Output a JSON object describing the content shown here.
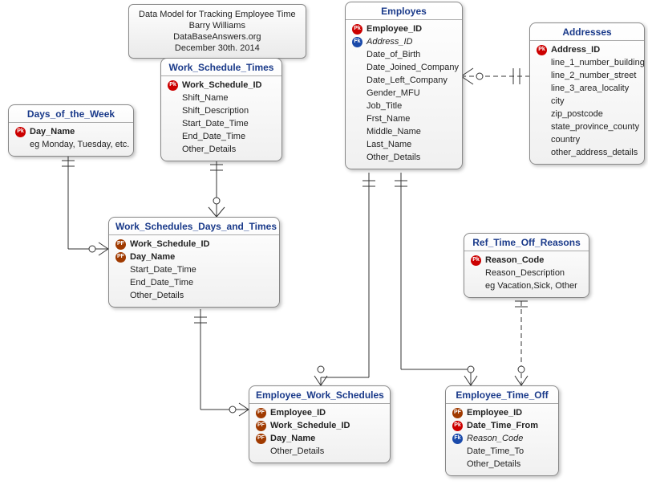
{
  "info_box": {
    "line1": "Data Model for Tracking Employee Time",
    "line2": "Barry Williams",
    "line3": "DataBaseAnswers.org",
    "line4": "December 30th. 2014"
  },
  "entities": {
    "employees": {
      "title": "Employes",
      "attrs": [
        {
          "key": "PK",
          "name": "Employee_ID",
          "bold": true
        },
        {
          "key": "FK",
          "name": "Address_ID",
          "italic": true
        },
        {
          "key": "",
          "name": "Date_of_Birth"
        },
        {
          "key": "",
          "name": "Date_Joined_Company"
        },
        {
          "key": "",
          "name": "Date_Left_Company"
        },
        {
          "key": "",
          "name": "Gender_MFU"
        },
        {
          "key": "",
          "name": "Job_Title"
        },
        {
          "key": "",
          "name": "Frst_Name"
        },
        {
          "key": "",
          "name": "Middle_Name"
        },
        {
          "key": "",
          "name": "Last_Name"
        },
        {
          "key": "",
          "name": "Other_Details"
        }
      ]
    },
    "addresses": {
      "title": "Addresses",
      "attrs": [
        {
          "key": "PK",
          "name": "Address_ID",
          "bold": true
        },
        {
          "key": "",
          "name": "line_1_number_building"
        },
        {
          "key": "",
          "name": "line_2_number_street"
        },
        {
          "key": "",
          "name": "line_3_area_locality"
        },
        {
          "key": "",
          "name": "city"
        },
        {
          "key": "",
          "name": "zip_postcode"
        },
        {
          "key": "",
          "name": "state_province_county"
        },
        {
          "key": "",
          "name": "country"
        },
        {
          "key": "",
          "name": "other_address_details"
        }
      ]
    },
    "work_schedule_times": {
      "title": "Work_Schedule_Times",
      "attrs": [
        {
          "key": "PK",
          "name": "Work_Schedule_ID",
          "bold": true
        },
        {
          "key": "",
          "name": "Shift_Name"
        },
        {
          "key": "",
          "name": "Shift_Description"
        },
        {
          "key": "",
          "name": "Start_Date_Time"
        },
        {
          "key": "",
          "name": "End_Date_Time"
        },
        {
          "key": "",
          "name": "Other_Details"
        }
      ]
    },
    "days_of_week": {
      "title": "Days_of_the_Week",
      "attrs": [
        {
          "key": "PK",
          "name": "Day_Name",
          "bold": true
        },
        {
          "key": "",
          "name": "eg Monday, Tuesday, etc."
        }
      ]
    },
    "work_schedules_days_times": {
      "title": "Work_Schedules_Days_and_Times",
      "attrs": [
        {
          "key": "PF",
          "name": "Work_Schedule_ID",
          "bold": true
        },
        {
          "key": "PF",
          "name": "Day_Name",
          "bold": true
        },
        {
          "key": "",
          "name": "Start_Date_Time"
        },
        {
          "key": "",
          "name": "End_Date_Time"
        },
        {
          "key": "",
          "name": "Other_Details"
        }
      ]
    },
    "ref_time_off_reasons": {
      "title": "Ref_Time_Off_Reasons",
      "attrs": [
        {
          "key": "PK",
          "name": "Reason_Code",
          "bold": true
        },
        {
          "key": "",
          "name": "Reason_Description"
        },
        {
          "key": "",
          "name": "eg Vacation,Sick, Other"
        }
      ]
    },
    "employee_work_schedules": {
      "title": "Employee_Work_Schedules",
      "attrs": [
        {
          "key": "PF",
          "name": "Employee_ID",
          "bold": true
        },
        {
          "key": "PF",
          "name": "Work_Schedule_ID",
          "bold": true
        },
        {
          "key": "PF",
          "name": "Day_Name",
          "bold": true
        },
        {
          "key": "",
          "name": "Other_Details"
        }
      ]
    },
    "employee_time_off": {
      "title": "Employee_Time_Off",
      "attrs": [
        {
          "key": "PF",
          "name": "Employee_ID",
          "bold": true
        },
        {
          "key": "PK",
          "name": "Date_Time_From",
          "bold": true
        },
        {
          "key": "FK",
          "name": "Reason_Code",
          "italic": true
        },
        {
          "key": "",
          "name": "Date_Time_To"
        },
        {
          "key": "",
          "name": "Other_Details"
        }
      ]
    }
  }
}
